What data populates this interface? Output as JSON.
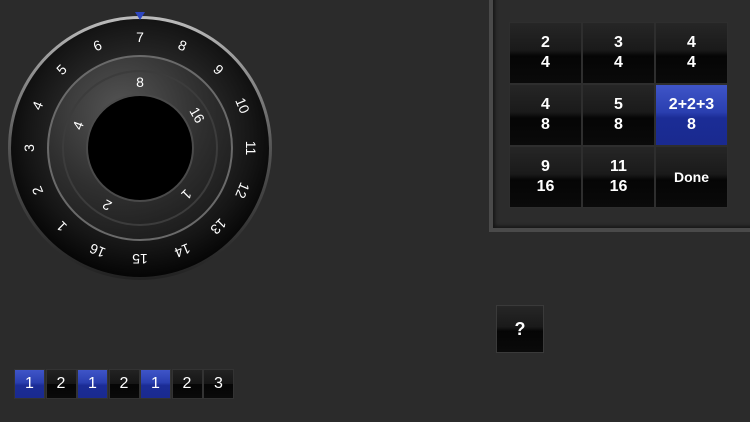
{
  "dial": {
    "outer_numbers": [
      "1",
      "2",
      "3",
      "4",
      "5",
      "6",
      "7",
      "8",
      "9",
      "10",
      "11",
      "12",
      "13",
      "14",
      "15",
      "16"
    ],
    "inner_numbers": [
      "8",
      "16",
      "1",
      "2",
      "4"
    ],
    "pointer_icon": "triangle-down-icon",
    "accent_color": "#2d46c0"
  },
  "meter_grid": [
    {
      "top": "2",
      "bottom": "4"
    },
    {
      "top": "3",
      "bottom": "4"
    },
    {
      "top": "4",
      "bottom": "4"
    },
    {
      "top": "4",
      "bottom": "8"
    },
    {
      "top": "5",
      "bottom": "8"
    },
    {
      "top": "2+2+3",
      "bottom": "8"
    },
    {
      "top": "9",
      "bottom": "16"
    },
    {
      "top": "11",
      "bottom": "16"
    },
    {
      "label": "Done"
    }
  ],
  "help": {
    "label": "?"
  },
  "beats": [
    {
      "label": "1"
    },
    {
      "label": "2"
    },
    {
      "label": "1"
    },
    {
      "label": "2"
    },
    {
      "label": "1"
    },
    {
      "label": "2"
    },
    {
      "label": "3"
    }
  ]
}
